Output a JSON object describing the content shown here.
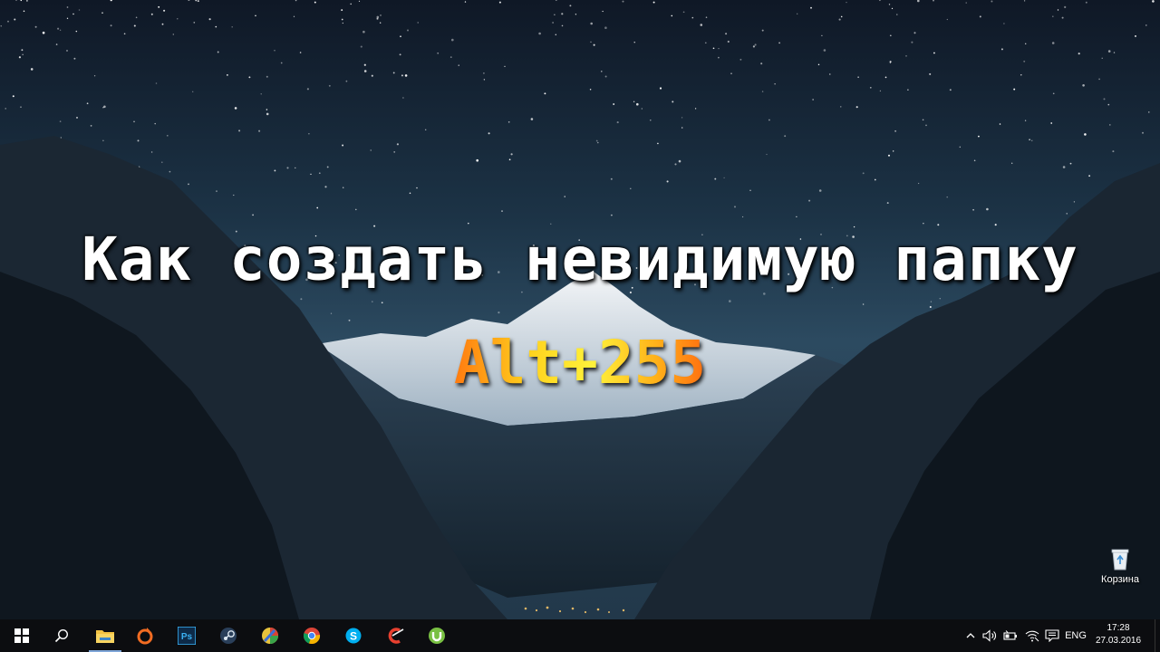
{
  "desktop": {
    "headline": "Как создать невидимую папку",
    "hotkey": "Alt+255",
    "icons": [
      {
        "label": "Корзина",
        "icon": "recycle-bin-icon"
      }
    ]
  },
  "taskbar": {
    "start_icon": "windows-start-icon",
    "search_icon": "search-icon",
    "apps": [
      {
        "name": "file-explorer",
        "icon": "folder-icon",
        "active": true
      },
      {
        "name": "origin",
        "icon": "origin-icon"
      },
      {
        "name": "photoshop",
        "icon": "photoshop-icon",
        "label": "Ps"
      },
      {
        "name": "steam",
        "icon": "steam-icon"
      },
      {
        "name": "paint",
        "icon": "paint-icon"
      },
      {
        "name": "chrome",
        "icon": "chrome-icon"
      },
      {
        "name": "skype",
        "icon": "skype-icon"
      },
      {
        "name": "ccleaner",
        "icon": "ccleaner-icon"
      },
      {
        "name": "utorrent",
        "icon": "utorrent-icon"
      }
    ],
    "tray": {
      "language": "ENG",
      "time": "17:28",
      "date": "27.03.2016"
    }
  },
  "colors": {
    "taskbar_bg": "#0c0d10",
    "sky_top": "#0f1826",
    "sky_mid": "#2a4a62",
    "hotkey_orange": "#ff7a10",
    "hotkey_yellow": "#fff23a"
  }
}
